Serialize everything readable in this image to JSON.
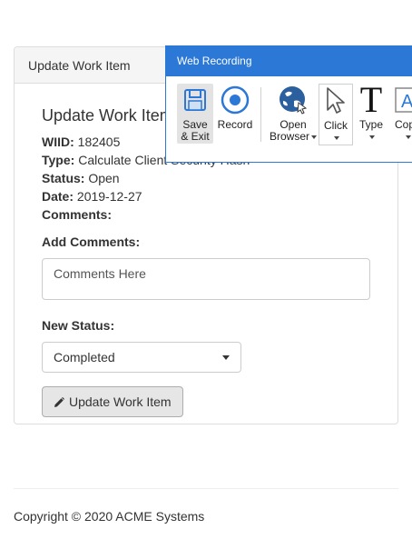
{
  "panel": {
    "heading": "Update Work Item",
    "title": "Update Work Item",
    "fields": [
      {
        "label": "WIID:",
        "value": "182405"
      },
      {
        "label": "Type:",
        "value": "Calculate Client Security Hash"
      },
      {
        "label": "Status:",
        "value": "Open"
      },
      {
        "label": "Date:",
        "value": "2019-12-27"
      },
      {
        "label": "Comments:",
        "value": ""
      }
    ],
    "add_comments_label": "Add Comments:",
    "comments_placeholder": "Comments Here",
    "new_status_label": "New Status:",
    "new_status_selected": "Completed",
    "update_button": "Update Work Item"
  },
  "footer": {
    "copyright": "Copyright © 2020 ACME Systems"
  },
  "recorder": {
    "title": "Web Recording",
    "buttons": [
      {
        "label_line1": "Save",
        "label_line2": "& Exit",
        "icon": "floppy-disk-icon"
      },
      {
        "label_line1": "Record",
        "label_line2": "",
        "icon": "record-icon"
      },
      {
        "label_line1": "Open",
        "label_line2": "Browser",
        "icon": "globe-icon"
      },
      {
        "label_line1": "Click",
        "label_line2": "",
        "icon": "cursor-icon"
      },
      {
        "label_line1": "Type",
        "label_line2": "",
        "icon": "text-t-icon"
      },
      {
        "label_line1": "Copy",
        "label_line2": "",
        "icon": "copy-text-icon"
      }
    ]
  },
  "colors": {
    "recorder_blue": "#2b78d6",
    "panel_heading_bg": "#f5f5f5",
    "button_bg": "#e6e6e6"
  }
}
